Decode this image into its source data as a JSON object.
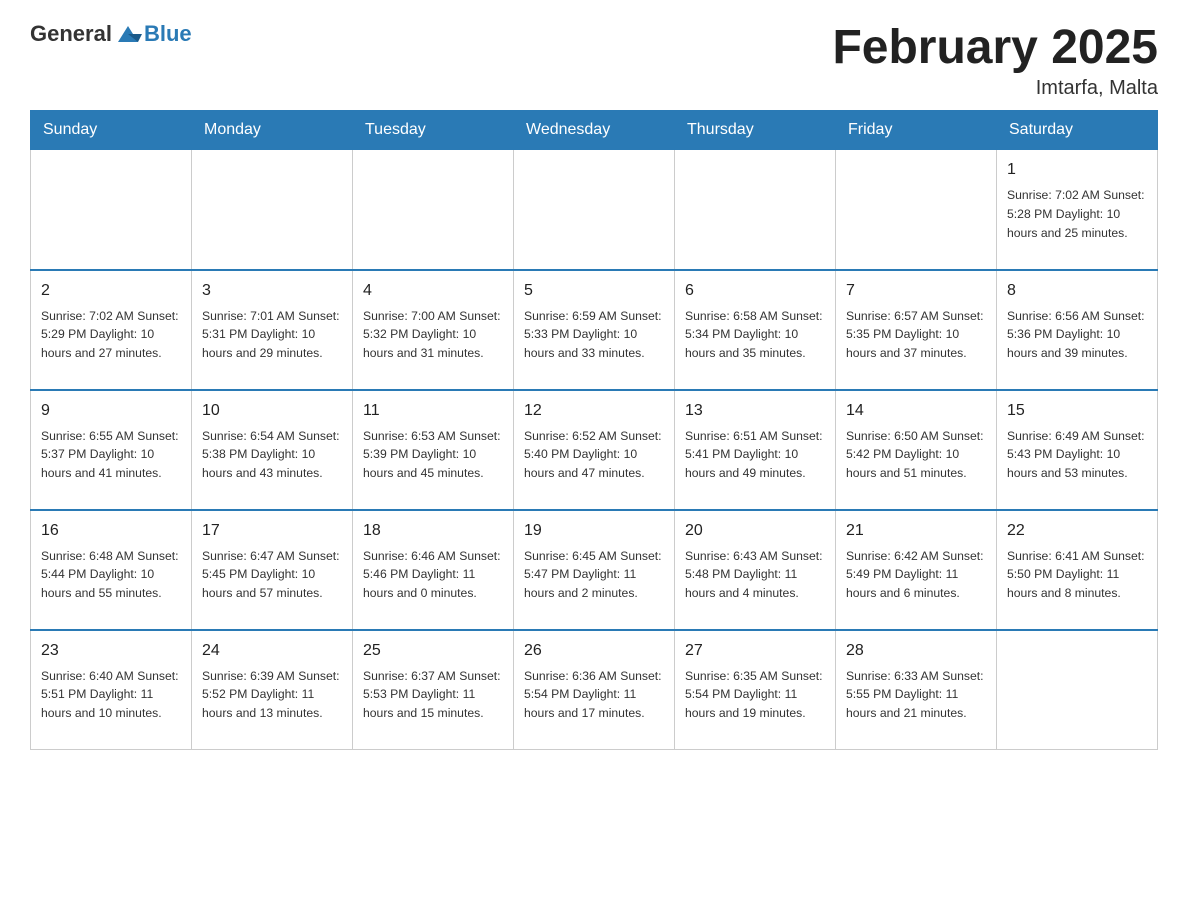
{
  "header": {
    "logo": {
      "general": "General",
      "blue": "Blue"
    },
    "title": "February 2025",
    "subtitle": "Imtarfa, Malta"
  },
  "calendar": {
    "days_of_week": [
      "Sunday",
      "Monday",
      "Tuesday",
      "Wednesday",
      "Thursday",
      "Friday",
      "Saturday"
    ],
    "weeks": [
      [
        {
          "day": "",
          "info": ""
        },
        {
          "day": "",
          "info": ""
        },
        {
          "day": "",
          "info": ""
        },
        {
          "day": "",
          "info": ""
        },
        {
          "day": "",
          "info": ""
        },
        {
          "day": "",
          "info": ""
        },
        {
          "day": "1",
          "info": "Sunrise: 7:02 AM\nSunset: 5:28 PM\nDaylight: 10 hours and 25 minutes."
        }
      ],
      [
        {
          "day": "2",
          "info": "Sunrise: 7:02 AM\nSunset: 5:29 PM\nDaylight: 10 hours and 27 minutes."
        },
        {
          "day": "3",
          "info": "Sunrise: 7:01 AM\nSunset: 5:31 PM\nDaylight: 10 hours and 29 minutes."
        },
        {
          "day": "4",
          "info": "Sunrise: 7:00 AM\nSunset: 5:32 PM\nDaylight: 10 hours and 31 minutes."
        },
        {
          "day": "5",
          "info": "Sunrise: 6:59 AM\nSunset: 5:33 PM\nDaylight: 10 hours and 33 minutes."
        },
        {
          "day": "6",
          "info": "Sunrise: 6:58 AM\nSunset: 5:34 PM\nDaylight: 10 hours and 35 minutes."
        },
        {
          "day": "7",
          "info": "Sunrise: 6:57 AM\nSunset: 5:35 PM\nDaylight: 10 hours and 37 minutes."
        },
        {
          "day": "8",
          "info": "Sunrise: 6:56 AM\nSunset: 5:36 PM\nDaylight: 10 hours and 39 minutes."
        }
      ],
      [
        {
          "day": "9",
          "info": "Sunrise: 6:55 AM\nSunset: 5:37 PM\nDaylight: 10 hours and 41 minutes."
        },
        {
          "day": "10",
          "info": "Sunrise: 6:54 AM\nSunset: 5:38 PM\nDaylight: 10 hours and 43 minutes."
        },
        {
          "day": "11",
          "info": "Sunrise: 6:53 AM\nSunset: 5:39 PM\nDaylight: 10 hours and 45 minutes."
        },
        {
          "day": "12",
          "info": "Sunrise: 6:52 AM\nSunset: 5:40 PM\nDaylight: 10 hours and 47 minutes."
        },
        {
          "day": "13",
          "info": "Sunrise: 6:51 AM\nSunset: 5:41 PM\nDaylight: 10 hours and 49 minutes."
        },
        {
          "day": "14",
          "info": "Sunrise: 6:50 AM\nSunset: 5:42 PM\nDaylight: 10 hours and 51 minutes."
        },
        {
          "day": "15",
          "info": "Sunrise: 6:49 AM\nSunset: 5:43 PM\nDaylight: 10 hours and 53 minutes."
        }
      ],
      [
        {
          "day": "16",
          "info": "Sunrise: 6:48 AM\nSunset: 5:44 PM\nDaylight: 10 hours and 55 minutes."
        },
        {
          "day": "17",
          "info": "Sunrise: 6:47 AM\nSunset: 5:45 PM\nDaylight: 10 hours and 57 minutes."
        },
        {
          "day": "18",
          "info": "Sunrise: 6:46 AM\nSunset: 5:46 PM\nDaylight: 11 hours and 0 minutes."
        },
        {
          "day": "19",
          "info": "Sunrise: 6:45 AM\nSunset: 5:47 PM\nDaylight: 11 hours and 2 minutes."
        },
        {
          "day": "20",
          "info": "Sunrise: 6:43 AM\nSunset: 5:48 PM\nDaylight: 11 hours and 4 minutes."
        },
        {
          "day": "21",
          "info": "Sunrise: 6:42 AM\nSunset: 5:49 PM\nDaylight: 11 hours and 6 minutes."
        },
        {
          "day": "22",
          "info": "Sunrise: 6:41 AM\nSunset: 5:50 PM\nDaylight: 11 hours and 8 minutes."
        }
      ],
      [
        {
          "day": "23",
          "info": "Sunrise: 6:40 AM\nSunset: 5:51 PM\nDaylight: 11 hours and 10 minutes."
        },
        {
          "day": "24",
          "info": "Sunrise: 6:39 AM\nSunset: 5:52 PM\nDaylight: 11 hours and 13 minutes."
        },
        {
          "day": "25",
          "info": "Sunrise: 6:37 AM\nSunset: 5:53 PM\nDaylight: 11 hours and 15 minutes."
        },
        {
          "day": "26",
          "info": "Sunrise: 6:36 AM\nSunset: 5:54 PM\nDaylight: 11 hours and 17 minutes."
        },
        {
          "day": "27",
          "info": "Sunrise: 6:35 AM\nSunset: 5:54 PM\nDaylight: 11 hours and 19 minutes."
        },
        {
          "day": "28",
          "info": "Sunrise: 6:33 AM\nSunset: 5:55 PM\nDaylight: 11 hours and 21 minutes."
        },
        {
          "day": "",
          "info": ""
        }
      ]
    ]
  }
}
